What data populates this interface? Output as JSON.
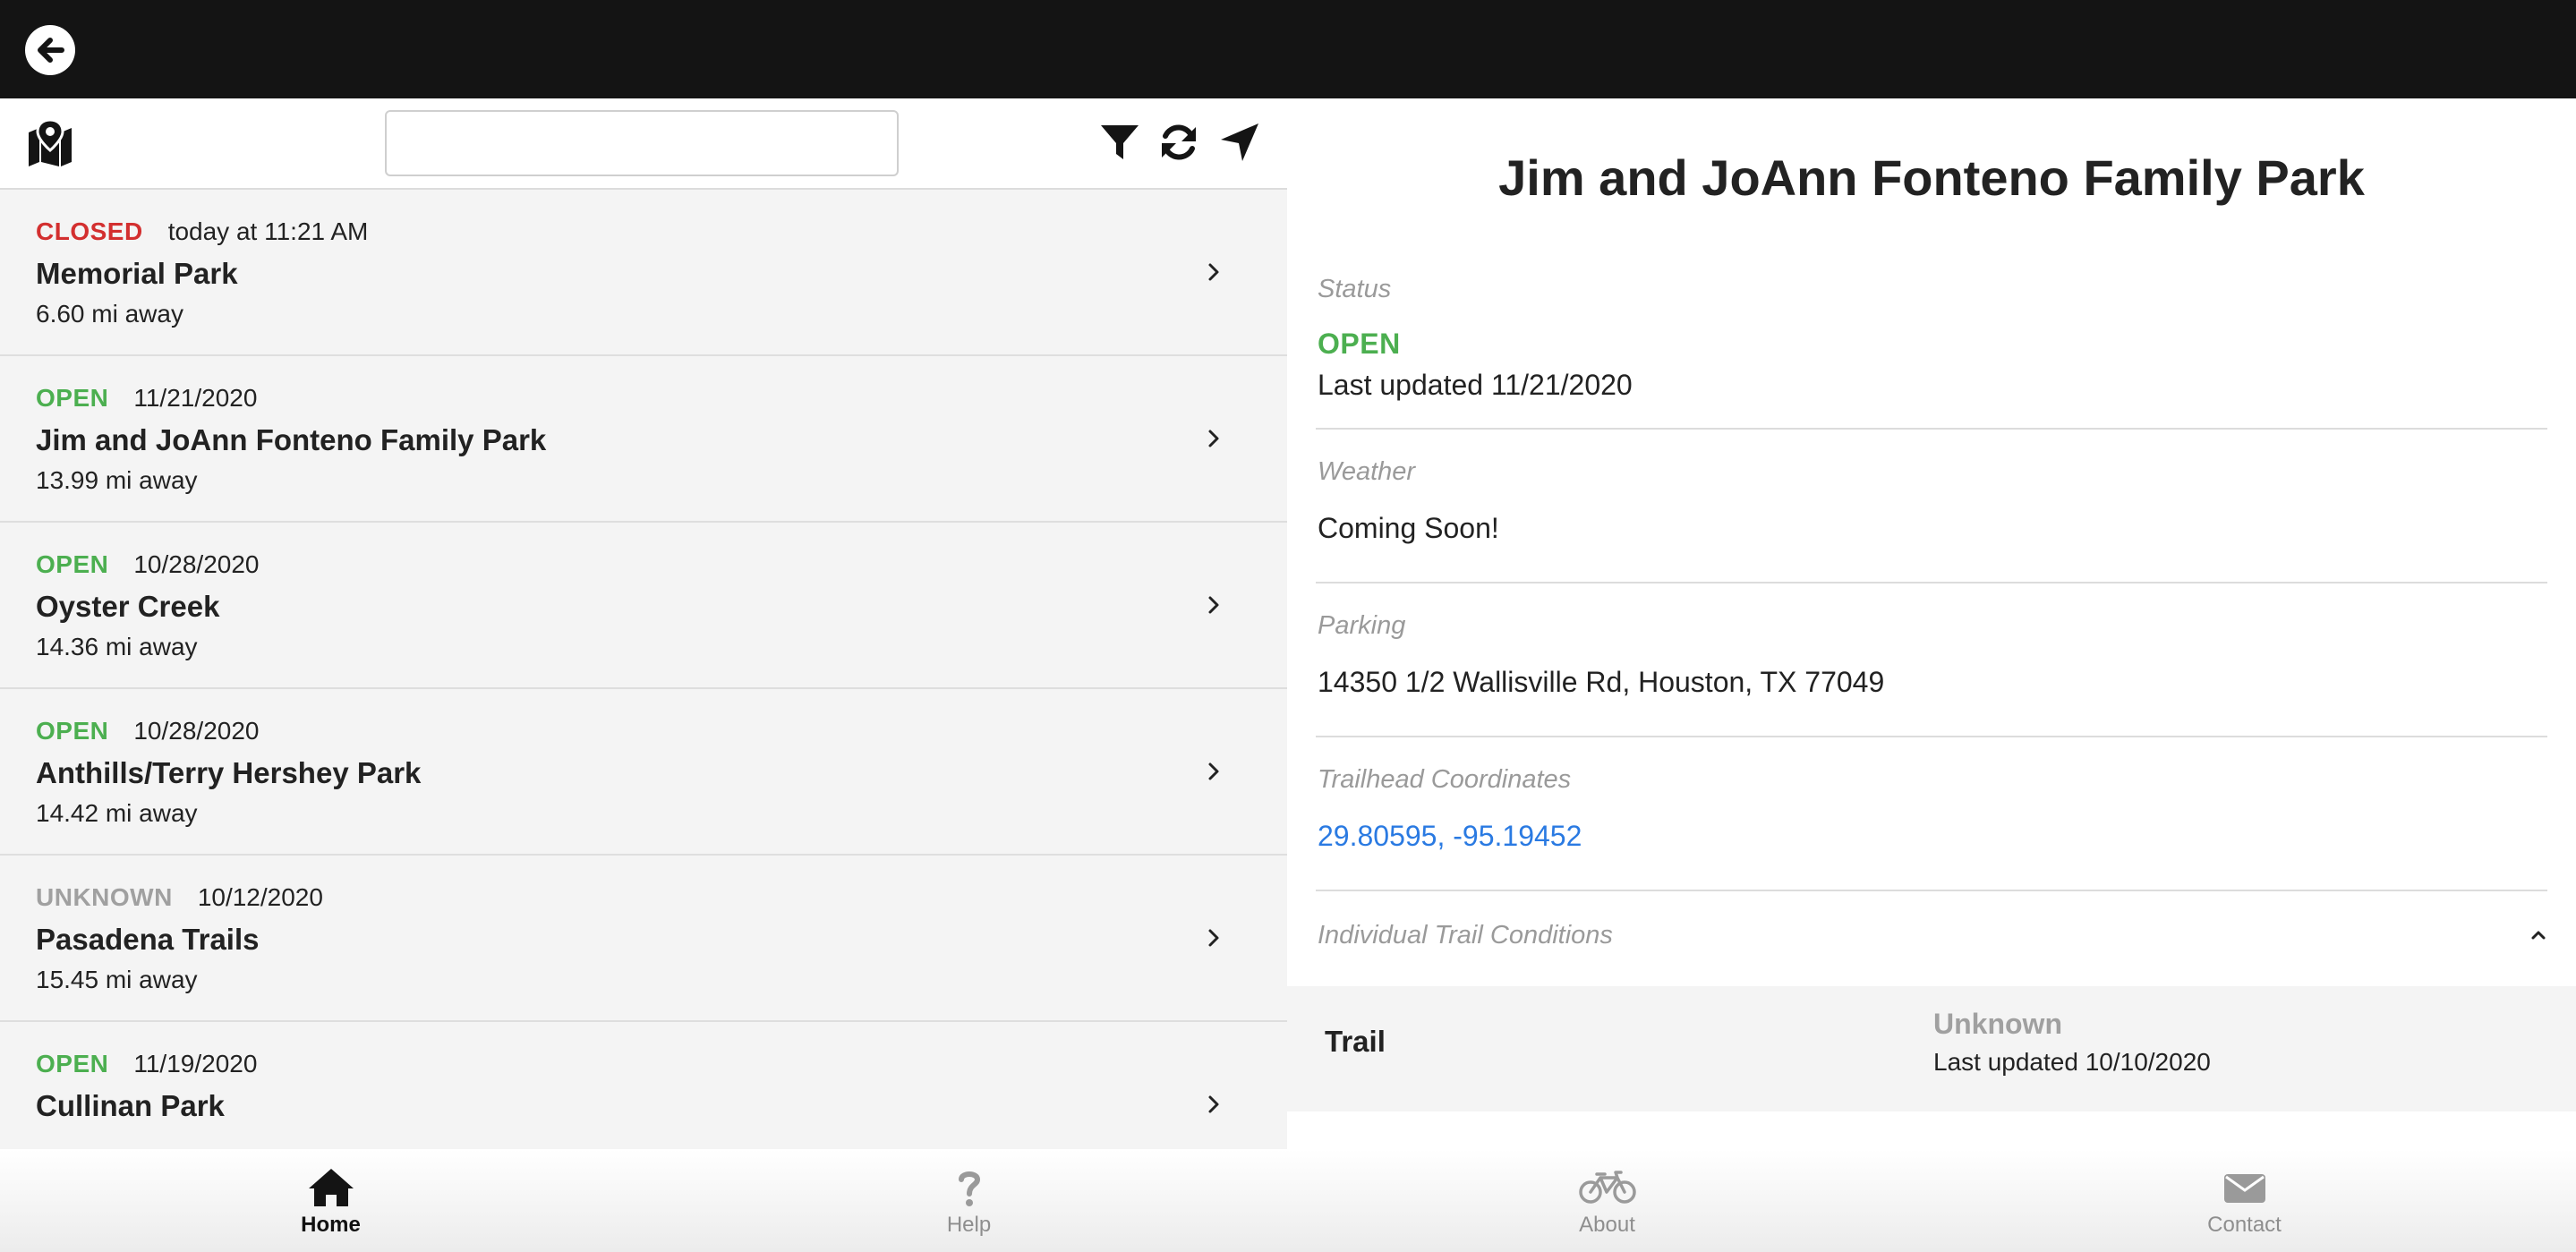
{
  "header": {
    "back_icon": "arrow-left-circle-icon"
  },
  "toolbar": {
    "map_icon": "map-pin-icon",
    "search": {
      "value": "",
      "placeholder": ""
    },
    "icons": [
      "filter-icon",
      "refresh-icon",
      "location-arrow-icon"
    ]
  },
  "park_list": [
    {
      "status": "CLOSED",
      "status_kind": "closed",
      "date": "today at 11:21 AM",
      "name": "Memorial Park",
      "distance": "6.60 mi away"
    },
    {
      "status": "OPEN",
      "status_kind": "open",
      "date": "11/21/2020",
      "name": "Jim and JoAnn Fonteno Family Park",
      "distance": "13.99 mi away"
    },
    {
      "status": "OPEN",
      "status_kind": "open",
      "date": "10/28/2020",
      "name": "Oyster Creek",
      "distance": "14.36 mi away"
    },
    {
      "status": "OPEN",
      "status_kind": "open",
      "date": "10/28/2020",
      "name": "Anthills/Terry Hershey Park",
      "distance": "14.42 mi away"
    },
    {
      "status": "UNKNOWN",
      "status_kind": "unknown",
      "date": "10/12/2020",
      "name": "Pasadena Trails",
      "distance": "15.45 mi away"
    },
    {
      "status": "OPEN",
      "status_kind": "open",
      "date": "11/19/2020",
      "name": "Cullinan Park",
      "distance": ""
    }
  ],
  "detail": {
    "title": "Jim and JoAnn Fonteno Family Park",
    "status_label": "Status",
    "status_value": "OPEN",
    "status_updated": "Last updated 11/21/2020",
    "weather_label": "Weather",
    "weather_value": "Coming Soon!",
    "parking_label": "Parking",
    "parking_value": "14350 1/2 Wallisville Rd, Houston, TX 77049",
    "coords_label": "Trailhead Coordinates",
    "coords_value": "29.80595, -95.19452",
    "conditions_label": "Individual Trail Conditions",
    "trail": {
      "name": "Trail",
      "status": "Unknown",
      "updated": "Last updated 10/10/2020"
    }
  },
  "tabs": [
    {
      "label": "Home",
      "icon": "home-icon",
      "active": true
    },
    {
      "label": "Help",
      "icon": "question-icon",
      "active": false
    },
    {
      "label": "About",
      "icon": "bicycle-icon",
      "active": false
    },
    {
      "label": "Contact",
      "icon": "envelope-icon",
      "active": false
    }
  ],
  "colors": {
    "open": "#4caf50",
    "closed": "#d32f2f",
    "unknown": "#a0a0a0",
    "link": "#2a7ae2",
    "topbar": "#141414"
  }
}
